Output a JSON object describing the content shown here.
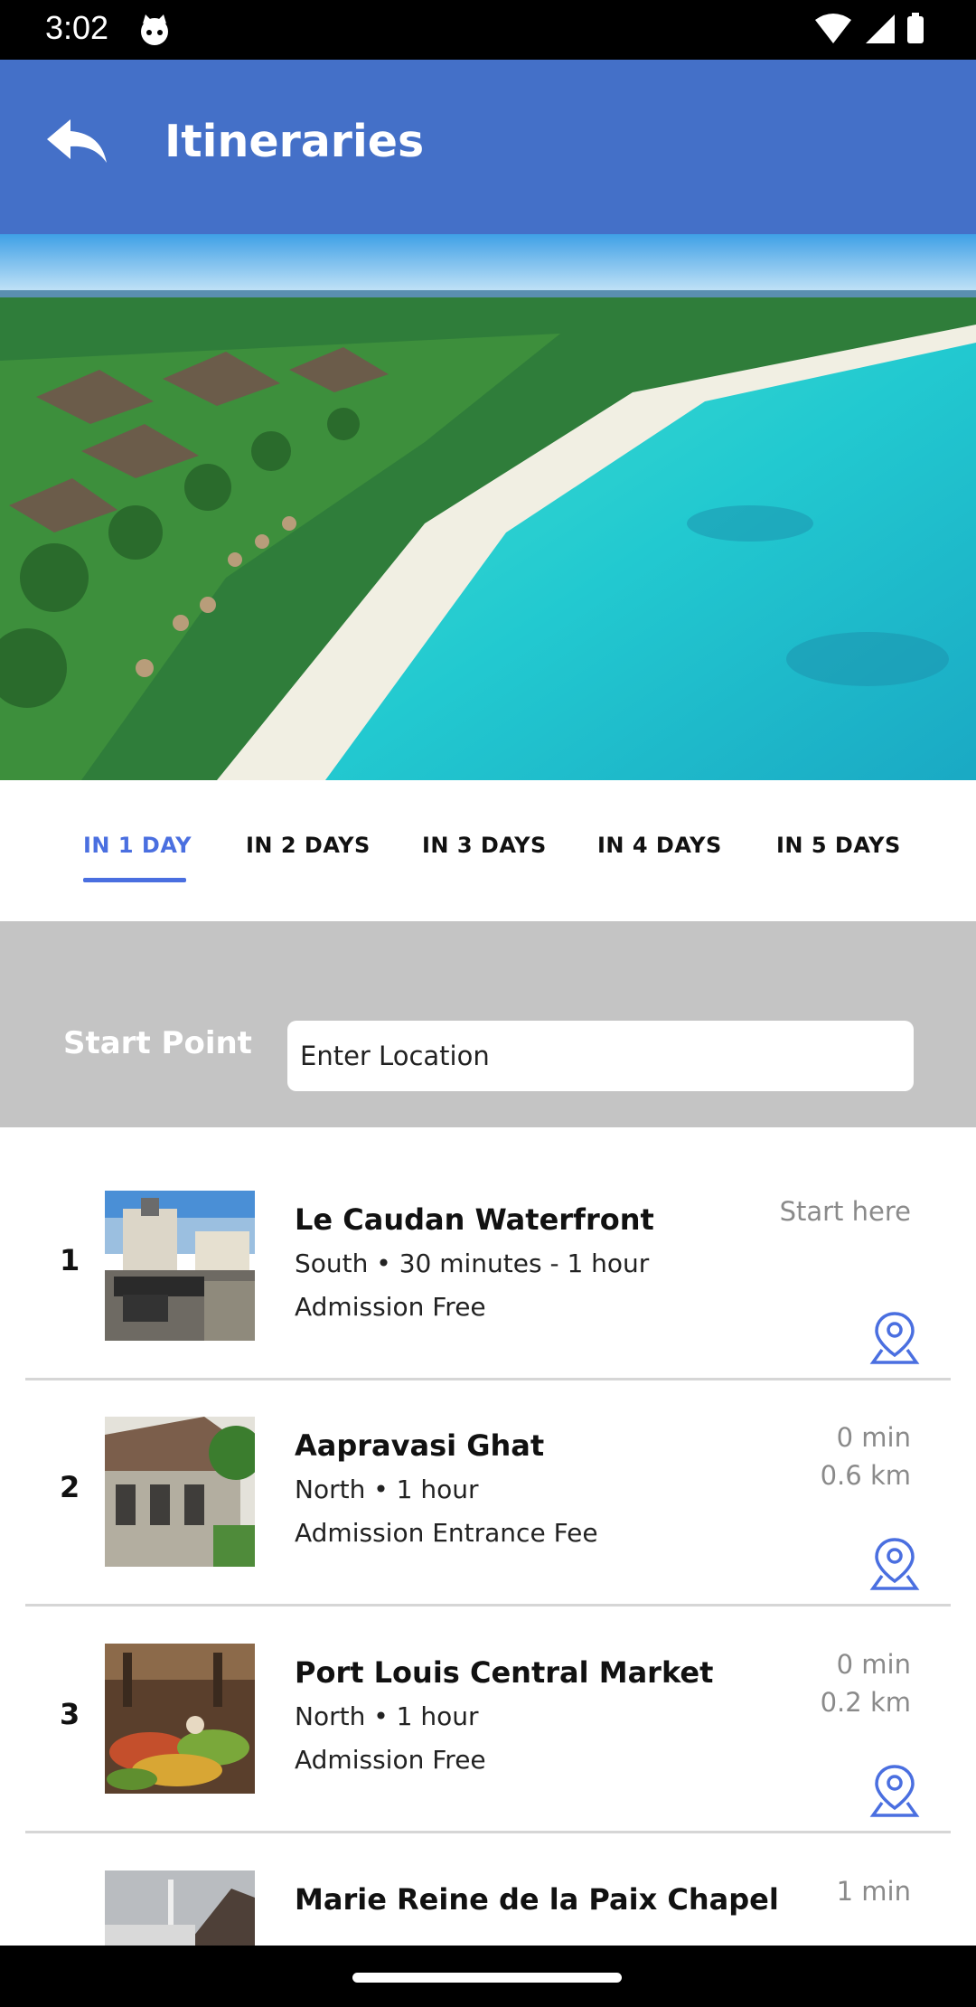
{
  "status_bar": {
    "time": "3:02"
  },
  "app_bar": {
    "title": "Itineraries",
    "color": "#4470c8"
  },
  "tabs": [
    {
      "label": "IN 1 DAY",
      "active": true
    },
    {
      "label": "IN 2 DAYS",
      "active": false
    },
    {
      "label": "IN 3 DAYS",
      "active": false
    },
    {
      "label": "IN 4 DAYS",
      "active": false
    },
    {
      "label": "IN 5 DAYS",
      "active": false
    }
  ],
  "start_point": {
    "label": "Start Point",
    "placeholder": "Enter Location"
  },
  "itinerary": [
    {
      "number": "1",
      "title": "Le Caudan Waterfront",
      "meta": "South • 30 minutes - 1 hour",
      "admission": "Admission Free",
      "right_line1": "Start here",
      "right_line2": ""
    },
    {
      "number": "2",
      "title": "Aapravasi Ghat",
      "meta": "North • 1 hour",
      "admission": "Admission Entrance Fee",
      "right_line1": "0 min",
      "right_line2": "0.6 km"
    },
    {
      "number": "3",
      "title": "Port Louis Central Market",
      "meta": "North • 1 hour",
      "admission": "Admission Free",
      "right_line1": "0 min",
      "right_line2": "0.2 km"
    },
    {
      "number": "",
      "title": "Marie Reine de la Paix Chapel",
      "meta": "",
      "admission": "",
      "right_line1": "1 min",
      "right_line2": ""
    }
  ],
  "colors": {
    "accent": "#4a6fe0",
    "band": "#c4c4c4"
  }
}
